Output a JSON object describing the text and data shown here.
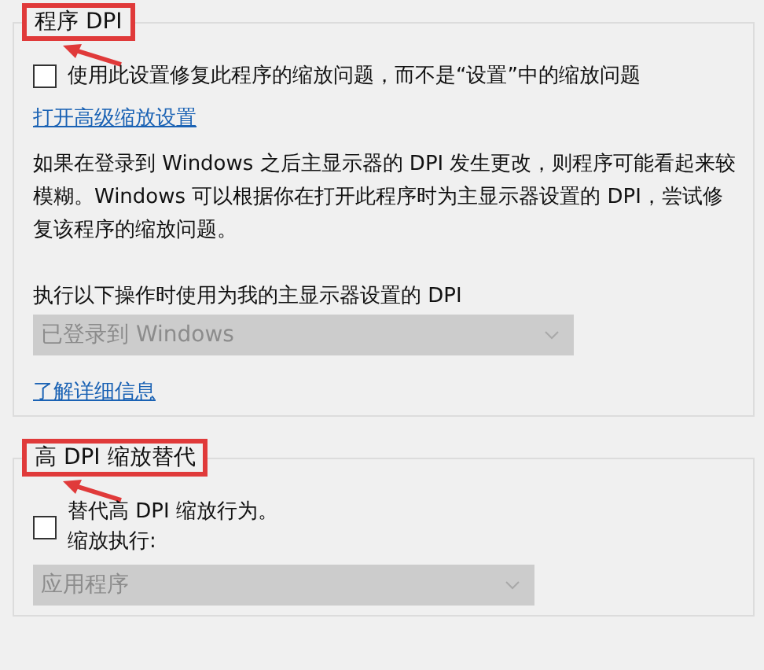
{
  "groups": [
    {
      "title": "程序 DPI",
      "highlighted": true,
      "arrow": true,
      "items": [
        {
          "kind": "checkbox",
          "label": "使用此设置修复此程序的缩放问题，而不是“设置”中的缩放问题",
          "checked": false
        },
        {
          "kind": "link",
          "text": "打开高级缩放设置"
        },
        {
          "kind": "paragraph",
          "text": "如果在登录到 Windows 之后主显示器的 DPI 发生更改，则程序可能看起来较模糊。Windows 可以根据你在打开此程序时为主显示器设置的 DPI，尝试修复该程序的缩放问题。"
        },
        {
          "kind": "label",
          "text": "执行以下操作时使用为我的主显示器设置的 DPI"
        },
        {
          "kind": "dropdown",
          "value": "已登录到 Windows",
          "disabled": true
        },
        {
          "kind": "link",
          "text": "了解详细信息"
        }
      ]
    },
    {
      "title": "高 DPI 缩放替代",
      "highlighted": true,
      "arrow": true,
      "items": [
        {
          "kind": "checkbox",
          "label": "替代高 DPI 缩放行为。",
          "sublabel": "缩放执行:",
          "checked": false
        },
        {
          "kind": "dropdown",
          "value": "应用程序",
          "disabled": true
        }
      ]
    }
  ]
}
